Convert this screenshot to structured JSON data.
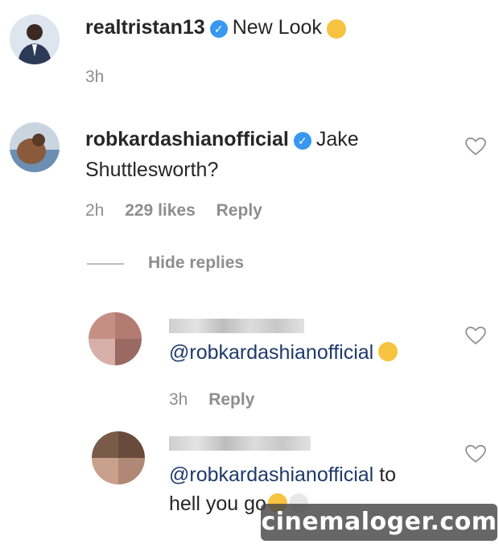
{
  "post": {
    "username": "realtristan13",
    "caption": "New Look",
    "time": "3h"
  },
  "comments": [
    {
      "username": "robkardashianofficial",
      "text_line1": "Jake",
      "text_line2": "Shuttlesworth?",
      "time": "2h",
      "likes": "229 likes",
      "reply_label": "Reply",
      "hide_replies_label": "Hide replies"
    }
  ],
  "replies": [
    {
      "mention": "@robkardashianofficial",
      "time": "3h",
      "reply_label": "Reply"
    },
    {
      "mention": "@robkardashianofficial",
      "text_after_mention": "to",
      "text_line2": "hell you go"
    }
  ],
  "watermark": "cinemaloger.com",
  "icons": {
    "verified": "verified-badge-icon",
    "heart": "heart-outline-icon",
    "emoji_wink": "winking-face-emoji",
    "emoji_cry": "loudly-crying-face-emoji",
    "emoji_skull": "skull-emoji"
  },
  "colors": {
    "verified": "#3897f0",
    "mention": "#1f3a6b",
    "meta": "#8e8e8e"
  }
}
